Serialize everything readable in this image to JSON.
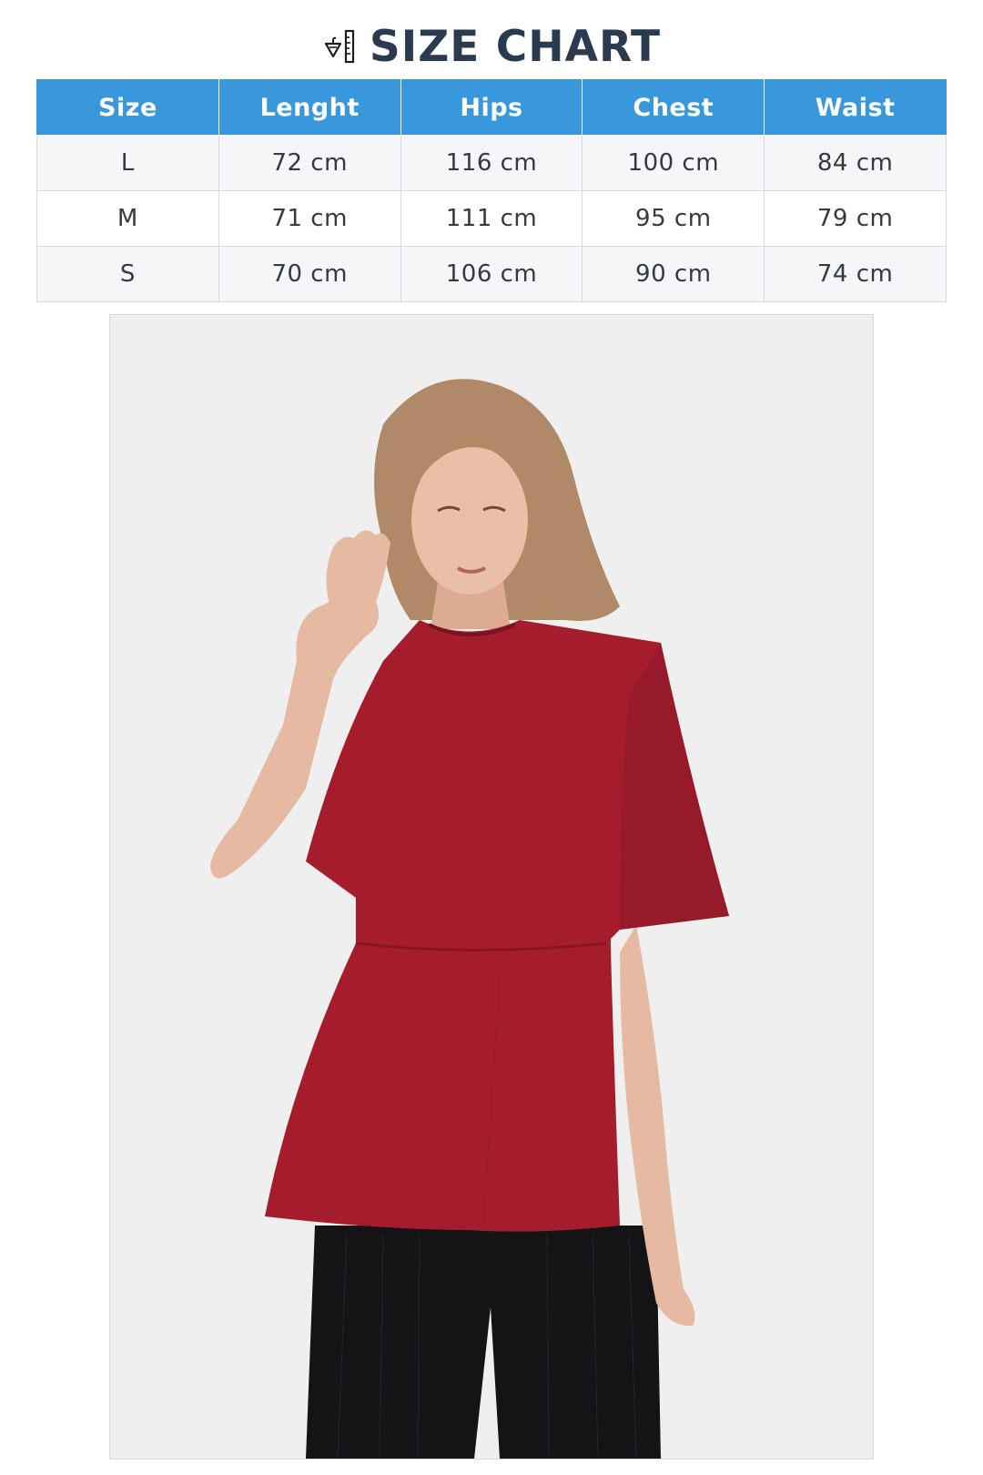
{
  "page": {
    "title": "SIZE CHART",
    "title_icon": "ruler-hanger-icon"
  },
  "size_table": {
    "headers": [
      "Size",
      "Lenght",
      "Hips",
      "Chest",
      "Waist"
    ],
    "rows": [
      [
        "L",
        "72 cm",
        "116 cm",
        "100 cm",
        "84 cm"
      ],
      [
        "M",
        "71 cm",
        "111 cm",
        "95 cm",
        "79 cm"
      ],
      [
        "S",
        "70 cm",
        "106 cm",
        "90 cm",
        "74 cm"
      ]
    ]
  },
  "product_photo": {
    "subject": "model-in-red-peplum-top",
    "colors": {
      "background": "#efefef",
      "top": "#a51d2c",
      "trousers": "#141417",
      "skin": "#e6b9a2",
      "hair": "#b08a68"
    }
  },
  "colors": {
    "title": "#2a3b50",
    "header_bg": "#3898db",
    "header_text": "#ffffff",
    "row_alt_bg": "#f4f6f8",
    "cell_text": "#333a40"
  }
}
